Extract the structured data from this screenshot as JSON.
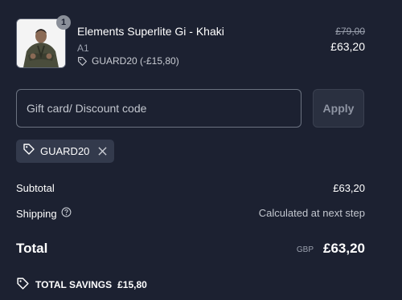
{
  "product": {
    "quantity": "1",
    "name": "Elements Superlite Gi - Khaki",
    "variant": "A1",
    "discount_applied": "GUARD20 (-£15,80)",
    "original_price": "£79,00",
    "price": "£63,20",
    "image_icon": "product-photo-gi"
  },
  "discount": {
    "placeholder": "Gift card/ Discount code",
    "apply_label": "Apply",
    "applied_code": "GUARD20"
  },
  "summary": {
    "subtotal_label": "Subtotal",
    "subtotal_value": "£63,20",
    "shipping_label": "Shipping",
    "shipping_value": "Calculated at next step",
    "total_label": "Total",
    "currency": "GBP",
    "total_value": "£63,20",
    "savings_label": "TOTAL SAVINGS",
    "savings_value": "£15,80"
  },
  "colors": {
    "background": "#1c2131",
    "text": "#ffffff",
    "muted": "#9aa0ad",
    "tag_bg": "#333a4c"
  }
}
